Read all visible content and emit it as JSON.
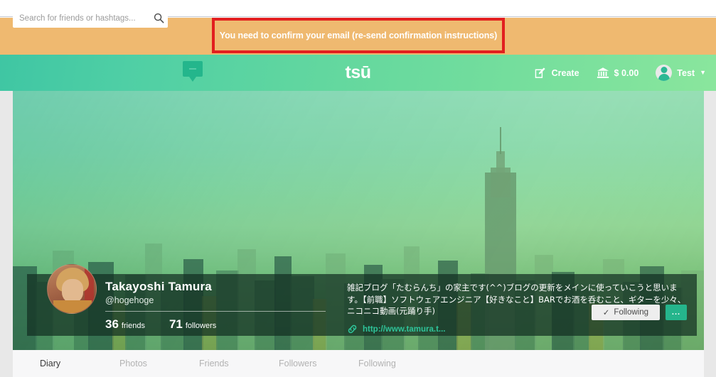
{
  "alert": {
    "message": "You need to confirm your email (re-send confirmation instructions)",
    "border_color": "#e21f1f",
    "bg_color": "#efb970"
  },
  "nav": {
    "search": {
      "placeholder": "Search for friends or hashtags...",
      "value": "",
      "icon": "search-icon"
    },
    "chat_icon": "chat-bubble-icon",
    "brand": "tsū",
    "create_label": "Create",
    "create_icon": "compose-pencil-icon",
    "balance": "$ 0.00",
    "bank_icon": "bank-icon",
    "account_name": "Test",
    "caret": "▼"
  },
  "profile": {
    "name": "Takayoshi Tamura",
    "handle": "@hogehoge",
    "friends_count": "36",
    "friends_label": "friends",
    "followers_count": "71",
    "followers_label": "followers",
    "bio": "雑記ブログ「たむらんち」の家主です(^^)ブログの更新をメインに使っていこうと思います。【前職】ソフトウェアエンジニア【好きなこと】BARでお酒を呑むこと、ギターを少々、ニコニコ動画(元踊り手)",
    "website": "http://www.tamura.t...",
    "link_icon": "link-chain-icon",
    "following_label": "Following",
    "following_check": "✓",
    "more_label": "...",
    "avatar": "user-avatar-photo",
    "cover": "nyc-skyline-cover-photo"
  },
  "tabs": [
    {
      "label": "Diary",
      "active": true
    },
    {
      "label": "Photos",
      "active": false
    },
    {
      "label": "Friends",
      "active": false
    },
    {
      "label": "Followers",
      "active": false
    },
    {
      "label": "Following",
      "active": false
    }
  ]
}
